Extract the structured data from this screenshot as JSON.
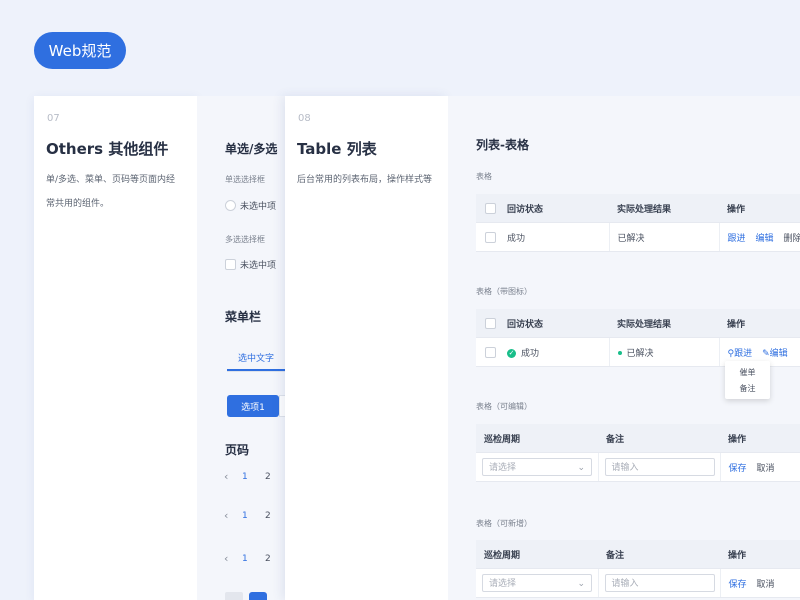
{
  "header": {
    "badge": "Web规范"
  },
  "card1": {
    "number": "07",
    "title": "Others 其他组件",
    "desc_line1": "单/多选、菜单、页码等页面内经",
    "desc_line2": "常共用的组件。"
  },
  "panel1": {
    "section_title": "单选/多选",
    "radio_group_label": "单选选择框",
    "radio_option": "未选中项",
    "checkbox_group_label": "多选选择框",
    "checkbox_option": "未选中项",
    "menu_title": "菜单栏",
    "menu_tab_active": "选中文字",
    "menu_button": "选项1",
    "pagination_title": "页码",
    "pages": [
      "1",
      "2"
    ]
  },
  "card2": {
    "number": "08",
    "title": "Table 列表",
    "desc": "后台常用的列表布局，操作样式等"
  },
  "panel2": {
    "section_title": "列表-表格",
    "table1": {
      "label": "表格",
      "headers": [
        "回访状态",
        "实际处理结果",
        "操作"
      ],
      "row": [
        "成功",
        "已解决"
      ],
      "actions": [
        "跟进",
        "编辑",
        "删除"
      ]
    },
    "table2": {
      "label": "表格（带图标）",
      "headers": [
        "回访状态",
        "实际处理结果",
        "操作"
      ],
      "row": [
        "成功",
        "已解决"
      ],
      "actions": [
        "跟进",
        "编辑"
      ],
      "dropdown": [
        "催单",
        "备注"
      ]
    },
    "table3": {
      "label": "表格（可编辑）",
      "headers": [
        "巡检周期",
        "备注",
        "操作"
      ],
      "select_placeholder": "请选择",
      "input_placeholder": "请输入",
      "actions": [
        "保存",
        "取消"
      ]
    },
    "table4": {
      "label": "表格（可新增）",
      "headers": [
        "巡检周期",
        "备注",
        "操作"
      ],
      "select_placeholder": "请选择",
      "input_placeholder": "请输入",
      "actions": [
        "保存",
        "取消"
      ]
    }
  },
  "colors": {
    "accent": "#2f6fe0",
    "background": "#eef2fb",
    "success": "#19be8a"
  }
}
